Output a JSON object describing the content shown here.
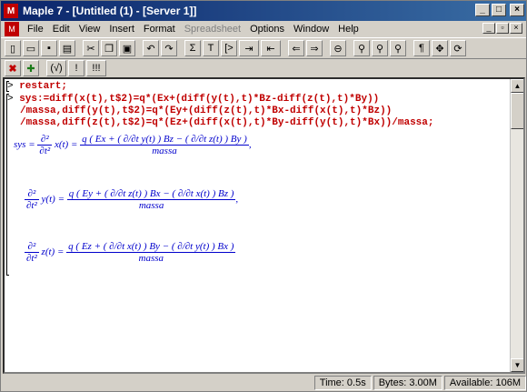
{
  "window": {
    "title": "Maple 7 - [Untitled (1) - [Server 1]]",
    "minimize": "_",
    "maximize": "□",
    "close": "×"
  },
  "menu": {
    "items": [
      "File",
      "Edit",
      "View",
      "Insert",
      "Format",
      "Spreadsheet",
      "Options",
      "Window",
      "Help"
    ]
  },
  "toolbar1": {
    "tools": [
      "new-doc-icon",
      "open-icon",
      "save-icon",
      "print-icon",
      "cut-icon",
      "copy-icon",
      "paste-icon",
      "undo-icon",
      "redo-icon",
      "sum-icon",
      "text-icon",
      "prompt-icon",
      "indent-icon",
      "outdent-icon",
      "back-icon",
      "forward-icon",
      "stop-icon",
      "zoom-small-icon",
      "zoom-normal-icon",
      "zoom-large-icon",
      "paragraph-icon",
      "expand-icon",
      "restart-icon"
    ],
    "labels": {
      "sum": "Σ",
      "text": "T",
      "prompt": "[>",
      "paragraph": "¶"
    }
  },
  "toolbar2": {
    "labels": {
      "stop": "✖",
      "interrupt": "✚",
      "check": "(√)",
      "bang": "!",
      "triple": "!!!"
    }
  },
  "worksheet": {
    "line1": "restart;",
    "line2": "sys:=diff(x(t),t$2)=q*(Ex+(diff(y(t),t)*Bz-diff(z(t),t)*By))",
    "line3": "/massa,diff(y(t),t$2)=q*(Ey+(diff(z(t),t)*Bx-diff(x(t),t)*Bz))",
    "line4": "/massa,diff(z(t),t$2)=q*(Ez+(diff(x(t),t)*By-diff(y(t),t)*Bx))/massa;",
    "output": {
      "sys_label": "sys",
      "eq1_lhs_var": "x(t)",
      "eq1_num": "q ( Ex + ( ∂/∂t y(t) ) Bz − ( ∂/∂t z(t) ) By )",
      "eq2_lhs_var": "y(t)",
      "eq2_num": "q ( Ey + ( ∂/∂t z(t) ) Bx − ( ∂/∂t x(t) ) Bz )",
      "eq3_lhs_var": "z(t)",
      "eq3_num": "q ( Ez + ( ∂/∂t x(t) ) By − ( ∂/∂t y(t) ) Bx )",
      "denominator": "massa"
    }
  },
  "status": {
    "time": "Time:   0.5s",
    "bytes": "Bytes: 3.00M",
    "available": "Available: 106M"
  }
}
